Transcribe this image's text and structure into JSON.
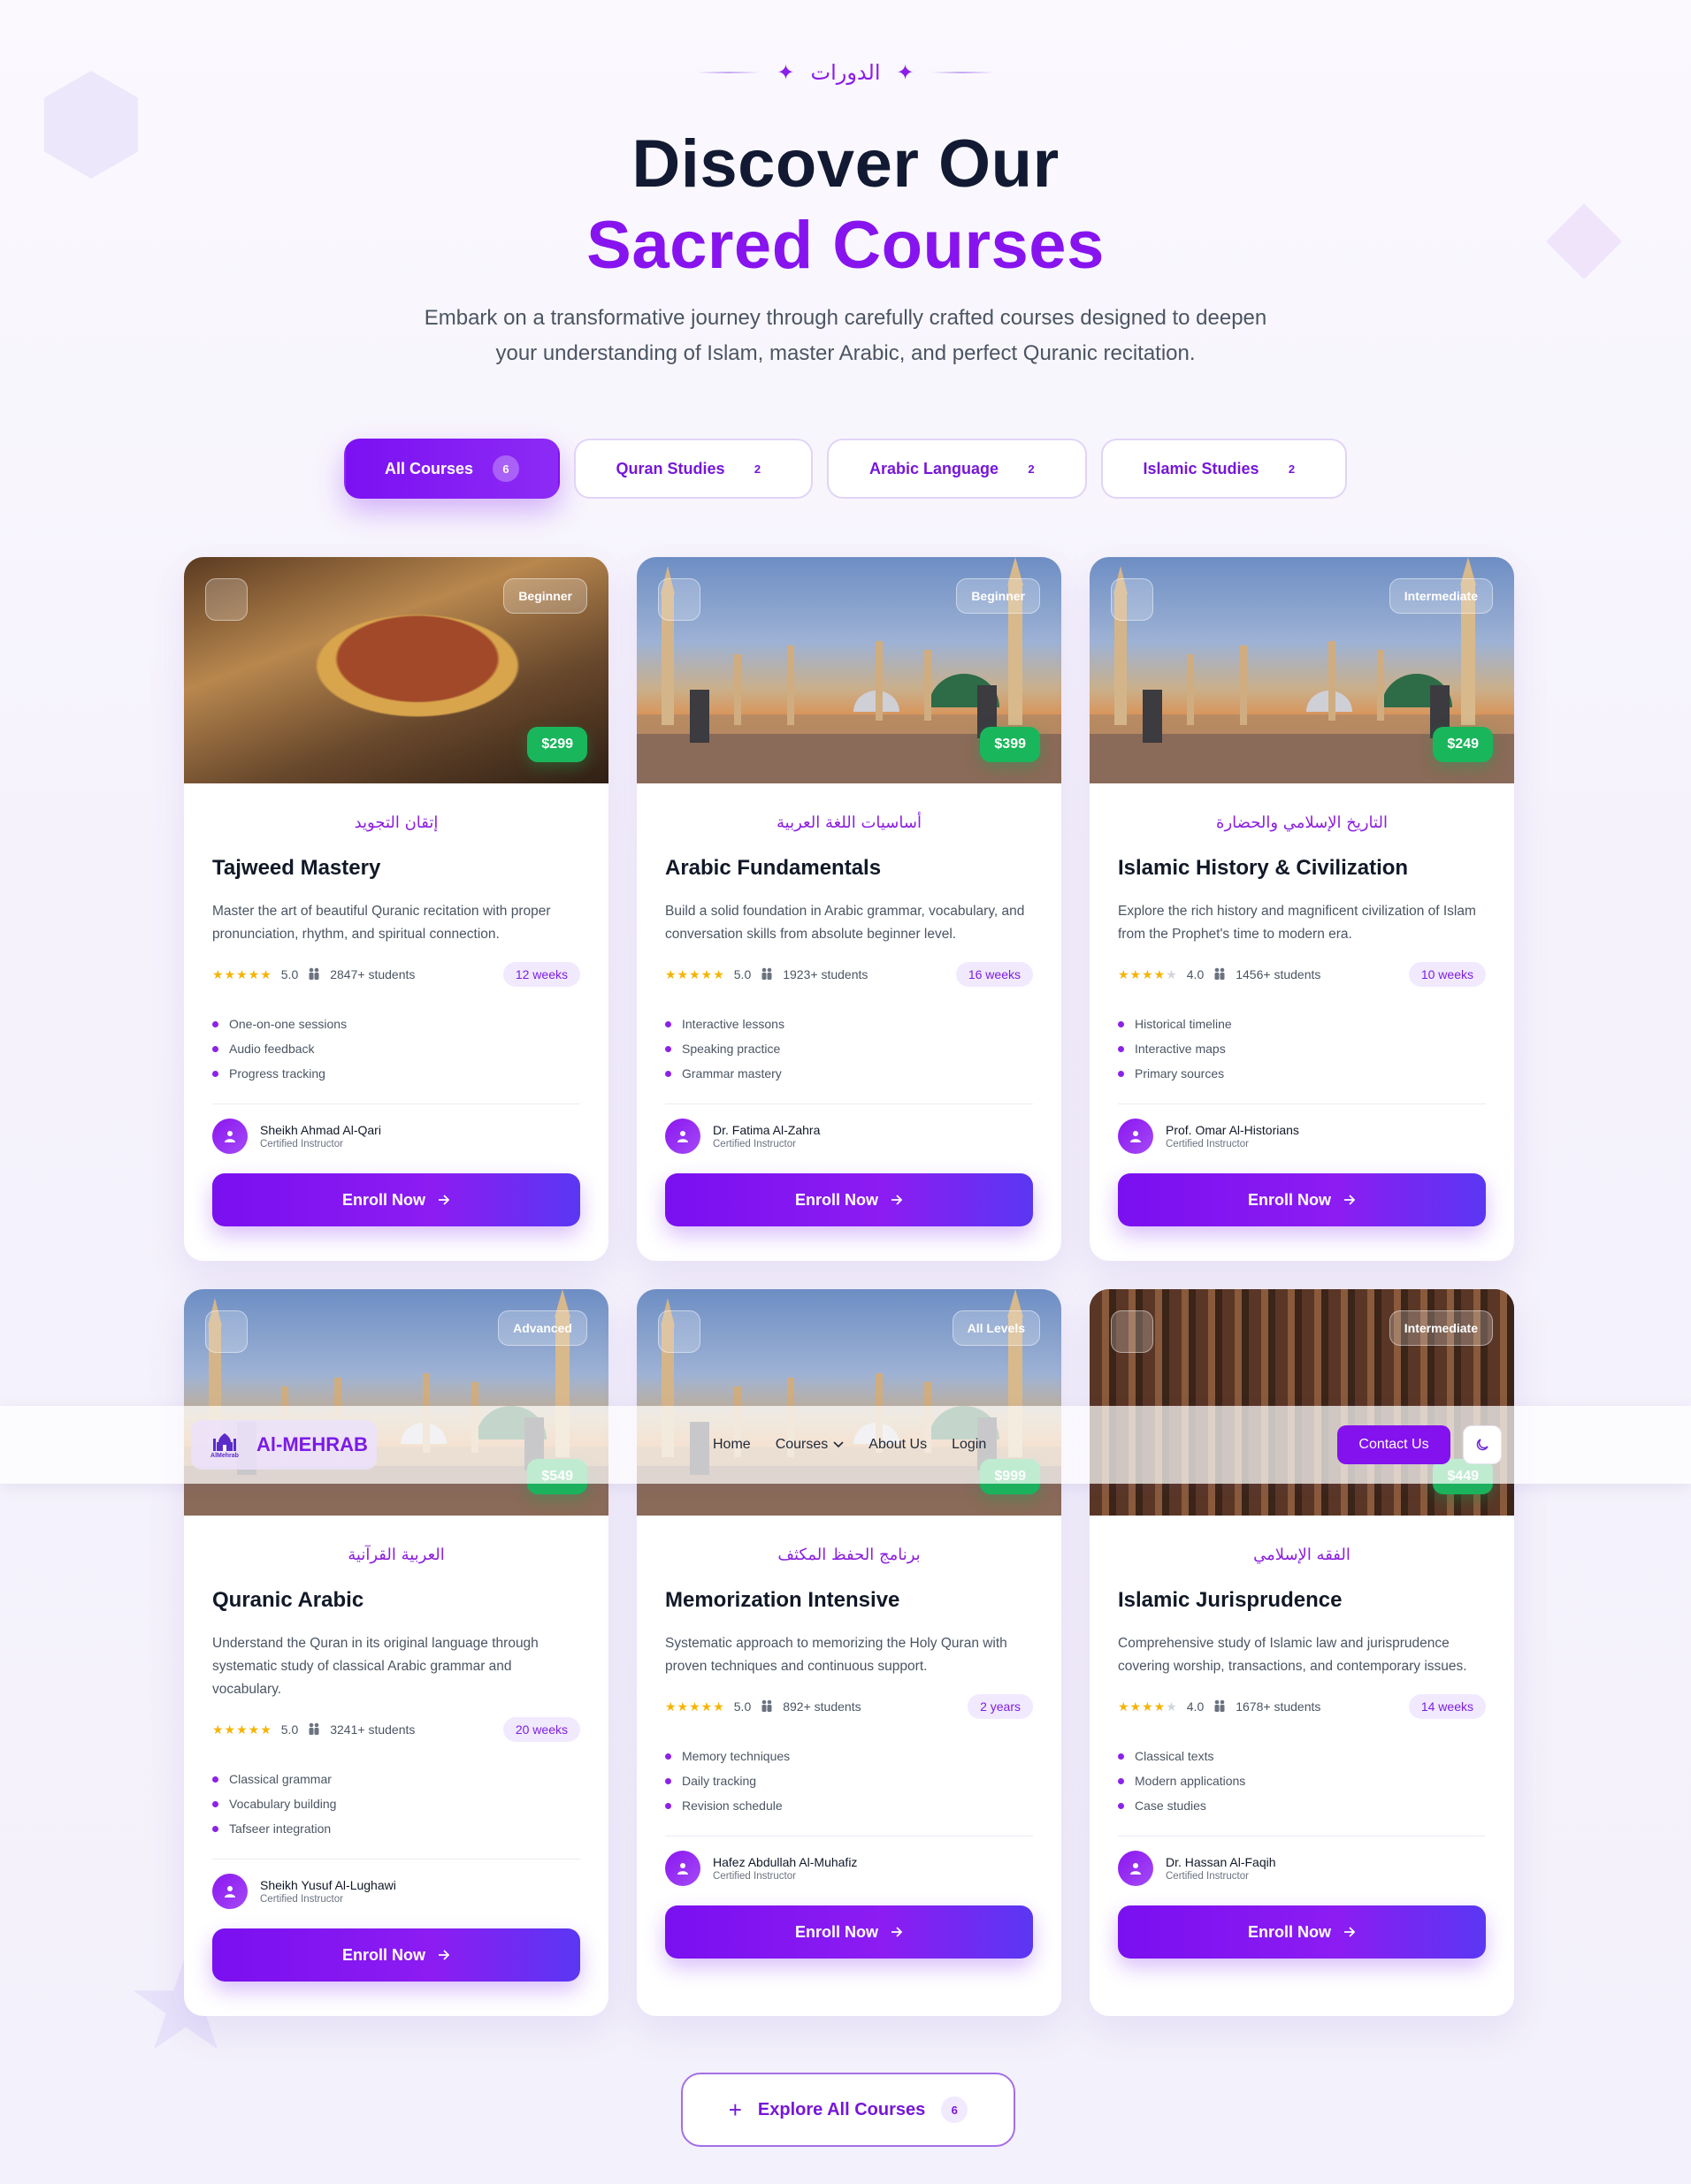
{
  "section_tag": "الدورات",
  "headline": {
    "line1": "Discover Our",
    "line2": "Sacred Courses"
  },
  "lead": "Embark on a transformative journey through carefully crafted courses designed to deepen your understanding of Islam, master Arabic, and perfect Quranic recitation.",
  "filters": [
    {
      "label": "All Courses",
      "count": "6",
      "active": true
    },
    {
      "label": "Quran Studies",
      "count": "2",
      "active": false
    },
    {
      "label": "Arabic Language",
      "count": "2",
      "active": false
    },
    {
      "label": "Islamic Studies",
      "count": "2",
      "active": false
    }
  ],
  "courses": [
    {
      "level": "Beginner",
      "price": "$299",
      "arabic": "إتقان التجويد",
      "title": "Tajweed Mastery",
      "desc": "Master the art of beautiful Quranic recitation with proper pronunciation, rhythm, and spiritual connection.",
      "rating": "5.0",
      "stars": 5,
      "students": "2847+ students",
      "duration": "12 weeks",
      "features": [
        "One-on-one sessions",
        "Audio feedback",
        "Progress tracking"
      ],
      "instructor": "Sheikh Ahmad Al-Qari",
      "role": "Certified Instructor",
      "cta": "Enroll Now",
      "image": "quran-book"
    },
    {
      "level": "Beginner",
      "price": "$399",
      "arabic": "أساسيات اللغة العربية",
      "title": "Arabic Fundamentals",
      "desc": "Build a solid foundation in Arabic grammar, vocabulary, and conversation skills from absolute beginner level.",
      "rating": "5.0",
      "stars": 5,
      "students": "1923+ students",
      "duration": "16 weeks",
      "features": [
        "Interactive lessons",
        "Speaking practice",
        "Grammar mastery"
      ],
      "instructor": "Dr. Fatima Al-Zahra",
      "role": "Certified Instructor",
      "cta": "Enroll Now",
      "image": "mosque"
    },
    {
      "level": "Intermediate",
      "price": "$249",
      "arabic": "التاريخ الإسلامي والحضارة",
      "title": "Islamic History & Civilization",
      "desc": "Explore the rich history and magnificent civilization of Islam from the Prophet's time to modern era.",
      "rating": "4.0",
      "stars": 4,
      "students": "1456+ students",
      "duration": "10 weeks",
      "features": [
        "Historical timeline",
        "Interactive maps",
        "Primary sources"
      ],
      "instructor": "Prof. Omar Al-Historians",
      "role": "Certified Instructor",
      "cta": "Enroll Now",
      "image": "mosque"
    },
    {
      "level": "Advanced",
      "price": "$549",
      "arabic": "العربية القرآنية",
      "title": "Quranic Arabic",
      "desc": "Understand the Quran in its original language through systematic study of classical Arabic grammar and vocabulary.",
      "rating": "5.0",
      "stars": 5,
      "students": "3241+ students",
      "duration": "20 weeks",
      "features": [
        "Classical grammar",
        "Vocabulary building",
        "Tafseer integration"
      ],
      "instructor": "Sheikh Yusuf Al-Lughawi",
      "role": "Certified Instructor",
      "cta": "Enroll Now",
      "image": "mosque"
    },
    {
      "level": "All Levels",
      "price": "$999",
      "arabic": "برنامج الحفظ المكثف",
      "title": "Memorization Intensive",
      "desc": "Systematic approach to memorizing the Holy Quran with proven techniques and continuous support.",
      "rating": "5.0",
      "stars": 5,
      "students": "892+ students",
      "duration": "2 years",
      "features": [
        "Memory techniques",
        "Daily tracking",
        "Revision schedule"
      ],
      "instructor": "Hafez Abdullah Al-Muhafiz",
      "role": "Certified Instructor",
      "cta": "Enroll Now",
      "image": "mosque"
    },
    {
      "level": "Intermediate",
      "price": "$449",
      "arabic": "الفقه الإسلامي",
      "title": "Islamic Jurisprudence",
      "desc": "Comprehensive study of Islamic law and jurisprudence covering worship, transactions, and contemporary issues.",
      "rating": "4.0",
      "stars": 4,
      "students": "1678+ students",
      "duration": "14 weeks",
      "features": [
        "Classical texts",
        "Modern applications",
        "Case studies"
      ],
      "instructor": "Dr. Hassan Al-Faqih",
      "role": "Certified Instructor",
      "cta": "Enroll Now",
      "image": "library"
    }
  ],
  "navbar": {
    "logo_mark": "AlMehrab",
    "logo_text": "Al-MEHRAB",
    "links": [
      "Home",
      "Courses",
      "About Us",
      "Login"
    ],
    "contact": "Contact Us",
    "theme_icon": "moon-icon"
  },
  "explore": {
    "label": "Explore All Courses",
    "count": "6"
  },
  "colors": {
    "accent": "#8714ee",
    "price": "#1ab65b",
    "heading": "#121a33"
  }
}
